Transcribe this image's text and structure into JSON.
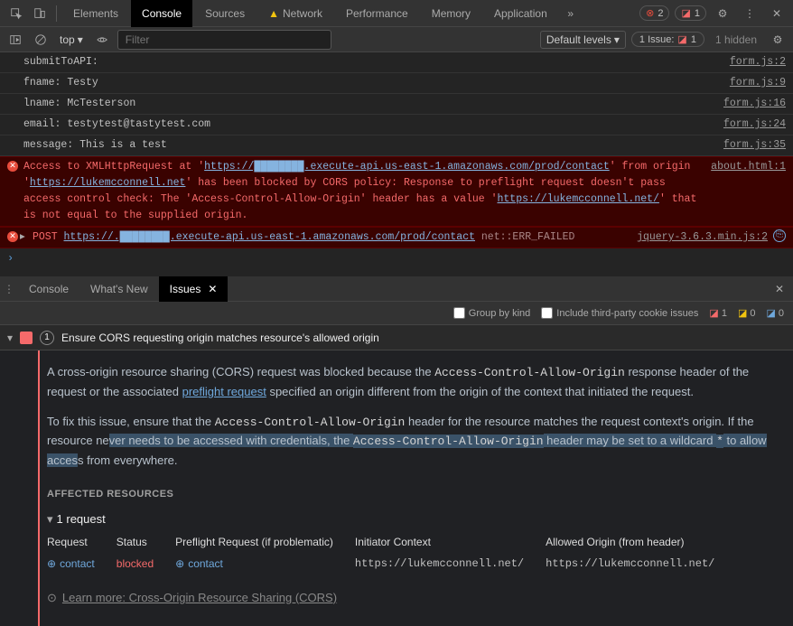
{
  "tabs": {
    "elements": "Elements",
    "console": "Console",
    "sources": "Sources",
    "network": "Network",
    "performance": "Performance",
    "memory": "Memory",
    "application": "Application"
  },
  "toolbar": {
    "error_count": "2",
    "issue_count": "1",
    "context": "top",
    "filter_placeholder": "Filter",
    "levels": "Default levels",
    "issue_label": "1 Issue:",
    "issue_num": "1",
    "hidden": "1 hidden"
  },
  "logs": [
    {
      "key": "submitToAPI:",
      "value": "",
      "src": "form.js:2"
    },
    {
      "key": "fname:",
      "value": "Testy",
      "src": "form.js:9"
    },
    {
      "key": "lname:",
      "value": "McTesterson",
      "src": "form.js:16"
    },
    {
      "key": "email:",
      "value": "testytest@tastytest.com",
      "src": "form.js:24"
    },
    {
      "key": "message:",
      "value": "This is a test",
      "src": "form.js:35"
    }
  ],
  "cors_error": {
    "pre1": "Access to XMLHttpRequest at '",
    "url1": "https://████████.execute-api.us-east-1.amazonaws.com/prod/contact",
    "post1": "' from origin '",
    "url2": "https://lukemcconnell.net",
    "post2": "' has been blocked by CORS policy: Response to preflight request doesn't pass access control check: The 'Access-Control-Allow-Origin' header has a value '",
    "url3": "https://lukemcconnell.net/",
    "post3": "' that is not equal to the supplied origin.",
    "src": "about.html:1"
  },
  "post_error": {
    "method": "POST",
    "url": "https://.████████.execute-api.us-east-1.amazonaws.com/prod/contact",
    "status": "net::ERR_FAILED",
    "src": "jquery-3.6.3.min.js:2"
  },
  "drawer": {
    "console": "Console",
    "whatsnew": "What's New",
    "issues": "Issues"
  },
  "issues_toolbar": {
    "group": "Group by kind",
    "third_party": "Include third-party cookie issues",
    "err": "1",
    "warn": "0",
    "info": "0"
  },
  "issue": {
    "count": "1",
    "title": "Ensure CORS requesting origin matches resource's allowed origin",
    "desc1_a": "A cross-origin resource sharing (CORS) request was blocked because the ",
    "desc1_code1": "Access-Control-Allow-Origin",
    "desc1_b": " response header of the request or the associated ",
    "desc1_link": "preflight request",
    "desc1_c": " specified an origin different from the origin of the context that initiated the request.",
    "desc2_a": "To fix this issue, ensure that the ",
    "desc2_code1": "Access-Control-Allow-Origin",
    "desc2_b": " header for the resource matches the request context's origin. If the resource ne",
    "desc2_hl1": "ver needs to be accessed with credentials, the ",
    "desc2_code2": "Access-Control-Allow-Origin",
    "desc2_hl2": " header may be set to a wildcard ",
    "desc2_code3": "*",
    "desc2_hl3": " to allow acces",
    "desc2_c": "s from everywhere.",
    "affected": "AFFECTED RESOURCES",
    "req_count": "1 request",
    "cols": {
      "request": "Request",
      "status": "Status",
      "preflight": "Preflight Request (if problematic)",
      "initiator": "Initiator Context",
      "allowed": "Allowed Origin (from header)"
    },
    "row": {
      "request": "contact",
      "status": "blocked",
      "preflight": "contact",
      "initiator": "https://lukemcconnell.net/",
      "allowed": "https://lukemcconnell.net/"
    },
    "learn": "Learn more: Cross-Origin Resource Sharing (CORS)"
  }
}
